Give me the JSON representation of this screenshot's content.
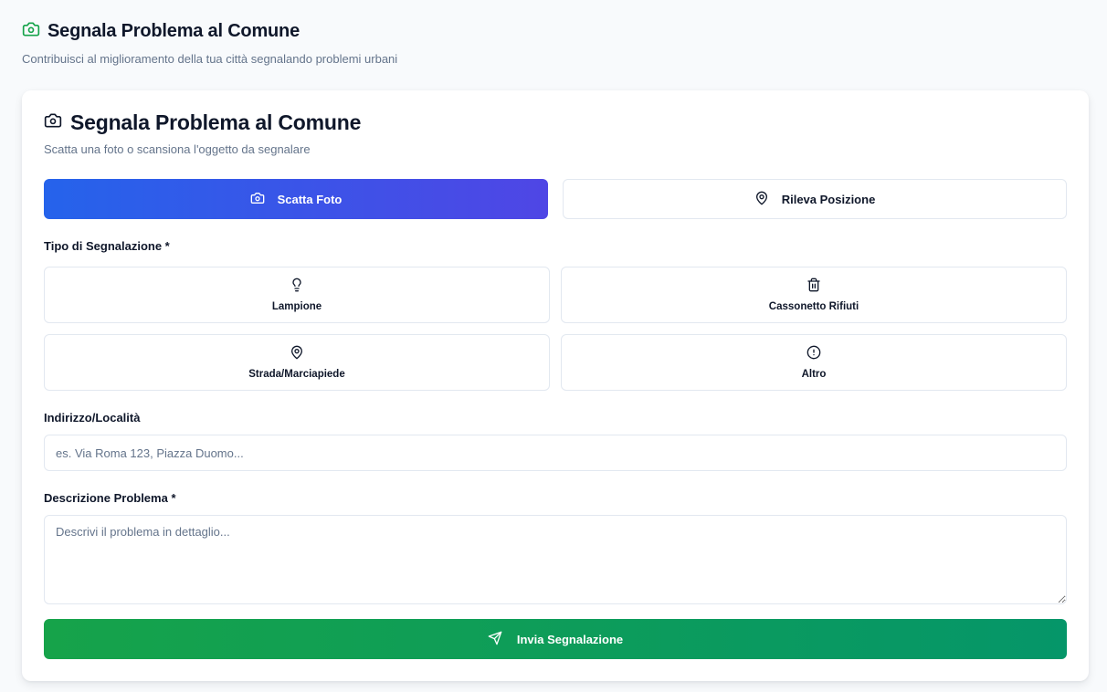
{
  "page": {
    "title": "Segnala Problema al Comune",
    "subtitle": "Contribuisci al miglioramento della tua città segnalando problemi urbani",
    "icon": "camera-icon"
  },
  "card": {
    "title": "Segnala Problema al Comune",
    "subtitle": "Scatta una foto o scansiona l'oggetto da segnalare",
    "icon": "camera-icon"
  },
  "actions": {
    "photo_label": "Scatta Foto",
    "location_label": "Rileva Posizione"
  },
  "report_type": {
    "label": "Tipo di Segnalazione *",
    "options": [
      {
        "label": "Lampione",
        "icon": "lightbulb-icon"
      },
      {
        "label": "Cassonetto Rifiuti",
        "icon": "trash-icon"
      },
      {
        "label": "Strada/Marciapiede",
        "icon": "map-pin-icon"
      },
      {
        "label": "Altro",
        "icon": "alert-circle-icon"
      }
    ]
  },
  "address": {
    "label": "Indirizzo/Località",
    "placeholder": "es. Via Roma 123, Piazza Duomo...",
    "value": ""
  },
  "description": {
    "label": "Descrizione Problema *",
    "placeholder": "Descrivi il problema in dettaglio...",
    "value": ""
  },
  "submit": {
    "label": "Invia Segnalazione",
    "icon": "send-icon"
  },
  "colors": {
    "background": "#f8fafc",
    "primary_gradient_start": "#2563eb",
    "primary_gradient_end": "#4f46e5",
    "submit_gradient_start": "#16a34a",
    "submit_gradient_end": "#059669",
    "header_icon": "#16a34a",
    "border": "#e2e8f0",
    "muted_text": "#64748b"
  }
}
